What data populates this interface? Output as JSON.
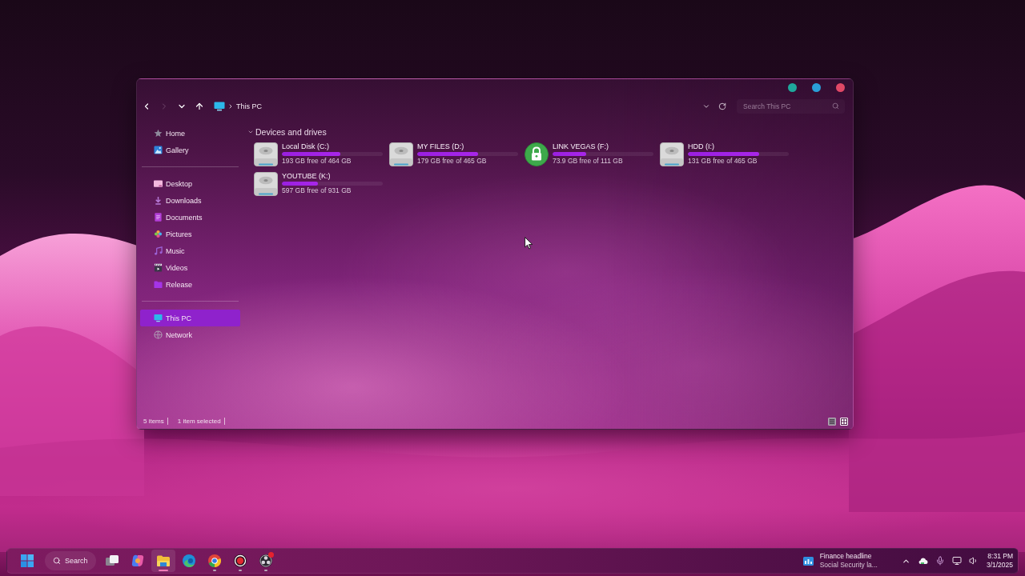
{
  "window": {
    "title_buttons": [
      {
        "color": "#1fa89c"
      },
      {
        "color": "#2a9fd8"
      },
      {
        "color": "#e04866"
      }
    ]
  },
  "navigation": {
    "buttons": [
      {
        "kind": "back",
        "disabled": false
      },
      {
        "kind": "forward",
        "disabled": true
      },
      {
        "kind": "recent",
        "disabled": false
      },
      {
        "kind": "up",
        "disabled": false
      }
    ],
    "breadcrumb": [
      {
        "label": "This PC"
      }
    ],
    "search": {
      "placeholder": "Search This PC"
    }
  },
  "sidebar": {
    "groups": [
      [
        {
          "label": "Home",
          "kind": "home",
          "selected": false
        },
        {
          "label": "Gallery",
          "kind": "gallery",
          "selected": false
        }
      ],
      [
        {
          "label": "Desktop",
          "kind": "desktop",
          "selected": false
        },
        {
          "label": "Downloads",
          "kind": "downloads",
          "selected": false
        },
        {
          "label": "Documents",
          "kind": "documents",
          "selected": false
        },
        {
          "label": "Pictures",
          "kind": "pictures",
          "selected": false
        },
        {
          "label": "Music",
          "kind": "music",
          "selected": false
        },
        {
          "label": "Videos",
          "kind": "videos",
          "selected": false
        },
        {
          "label": "Release",
          "kind": "folder",
          "selected": false
        }
      ],
      [
        {
          "label": "This PC",
          "kind": "pc",
          "selected": true
        },
        {
          "label": "Network",
          "kind": "network",
          "selected": false
        }
      ]
    ]
  },
  "section": {
    "title": "Devices and drives",
    "expanded": true
  },
  "drives": [
    {
      "name": "Local Disk (C:)",
      "kind": "disk",
      "level": 0.58,
      "free": "193 GB free of 464 GB"
    },
    {
      "name": "MY FILES (D:)",
      "kind": "disk",
      "level": 0.6,
      "free": "179 GB free of 465 GB"
    },
    {
      "name": "LINK VEGAS (F:)",
      "kind": "locked",
      "level": 0.33,
      "free": "73.9 GB free of 111 GB"
    },
    {
      "name": "HDD (I:)",
      "kind": "disk",
      "level": 0.71,
      "free": "131 GB free of 465 GB"
    },
    {
      "name": "YOUTUBE (K:)",
      "kind": "disk",
      "level": 0.36,
      "free": "597 GB free of 931 GB"
    }
  ],
  "status_bar": {
    "items": [
      "5 items",
      "1 item selected"
    ],
    "views": [
      {
        "kind": "details",
        "selected": false
      },
      {
        "kind": "tiles",
        "selected": true
      }
    ]
  },
  "taskbar": {
    "search": {
      "label": "Search"
    },
    "apps": [
      {
        "kind": "task-view",
        "running": false,
        "active": false,
        "notification": false
      },
      {
        "kind": "copilot",
        "running": false,
        "active": false,
        "notification": false
      },
      {
        "kind": "explorer",
        "running": true,
        "active": true,
        "notification": false
      },
      {
        "kind": "edge",
        "running": false,
        "active": false,
        "notification": false
      },
      {
        "kind": "chrome",
        "running": true,
        "active": false,
        "notification": false
      },
      {
        "kind": "recorder",
        "running": true,
        "active": false,
        "notification": false
      },
      {
        "kind": "obs",
        "running": true,
        "active": false,
        "notification": true
      }
    ],
    "news": {
      "title": "Finance headline",
      "subtitle": "Social Security la..."
    },
    "tray": [
      {
        "kind": "overflow"
      },
      {
        "kind": "app"
      },
      {
        "kind": "microphone"
      },
      {
        "kind": "display"
      },
      {
        "kind": "volume"
      }
    ],
    "time": "8:31 PM",
    "date": "3/1/2025"
  }
}
